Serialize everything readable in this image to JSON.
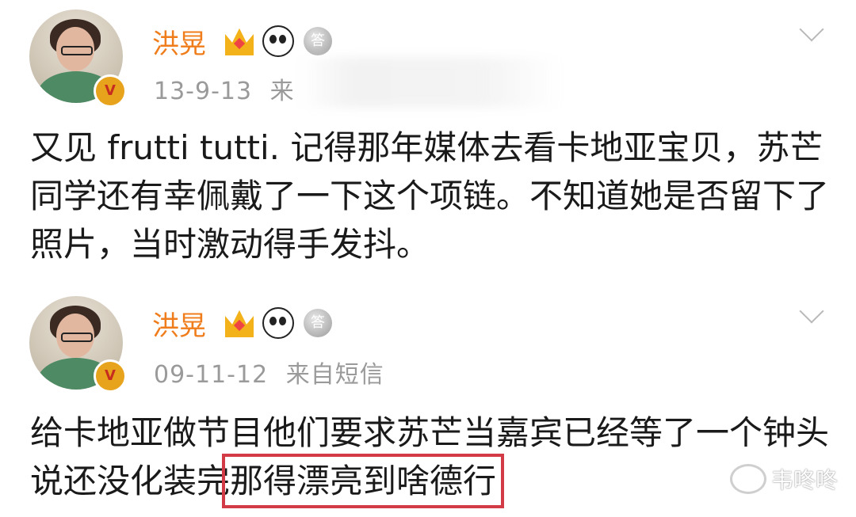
{
  "posts": [
    {
      "username": "洪晃",
      "badge": "V",
      "timestamp": "13-9-13",
      "source": "来",
      "content": "又见 frutti tutti. 记得那年媒体去看卡地亚宝贝，苏芒同学还有幸佩戴了一下这个项链。不知道她是否留下了照片，当时激动得手发抖。"
    },
    {
      "username": "洪晃",
      "badge": "V",
      "timestamp": "09-11-12",
      "source": "来自短信",
      "content_part1": "给卡地亚做节目他们要求苏芒当嘉宾已经等了一个钟头说还没化装完",
      "content_highlight": "那得漂亮到啥德行"
    }
  ],
  "badges": {
    "medal_char": "答"
  },
  "watermark": {
    "text": "韦咚咚"
  },
  "colors": {
    "username": "#f07d1b",
    "meta": "#9a9a9a",
    "highlight_box": "#d23a45"
  }
}
